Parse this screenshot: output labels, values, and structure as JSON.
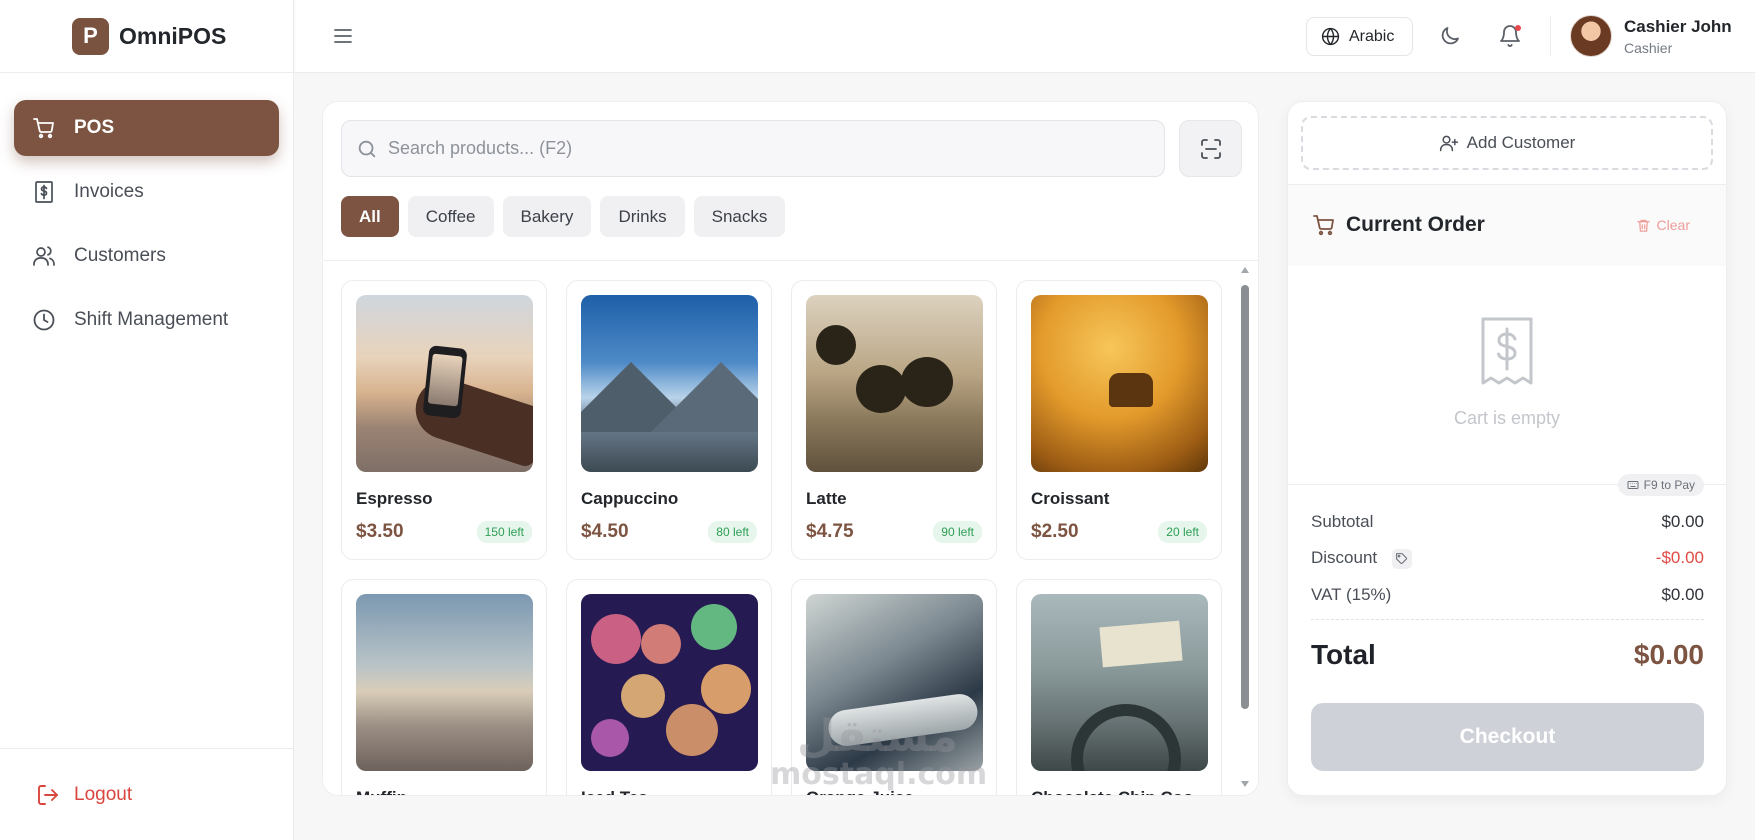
{
  "app": {
    "logo_letter": "P",
    "name": "OmniPOS"
  },
  "sidebar": {
    "items": [
      {
        "label": "POS",
        "icon": "cart-icon",
        "active": true
      },
      {
        "label": "Invoices",
        "icon": "invoice-icon",
        "active": false
      },
      {
        "label": "Customers",
        "icon": "users-icon",
        "active": false
      },
      {
        "label": "Shift Management",
        "icon": "clock-icon",
        "active": false
      }
    ],
    "logout_label": "Logout"
  },
  "header": {
    "language_label": "Arabic",
    "user": {
      "name": "Cashier John",
      "role": "Cashier"
    }
  },
  "search": {
    "placeholder": "Search products... (F2)",
    "value": ""
  },
  "categories": [
    {
      "label": "All",
      "active": true
    },
    {
      "label": "Coffee",
      "active": false
    },
    {
      "label": "Bakery",
      "active": false
    },
    {
      "label": "Drinks",
      "active": false
    },
    {
      "label": "Snacks",
      "active": false
    }
  ],
  "products": [
    {
      "name": "Espresso",
      "price": "$3.50",
      "stock": "150 left"
    },
    {
      "name": "Cappuccino",
      "price": "$4.50",
      "stock": "80 left"
    },
    {
      "name": "Latte",
      "price": "$4.75",
      "stock": "90 left"
    },
    {
      "name": "Croissant",
      "price": "$2.50",
      "stock": "20 left"
    },
    {
      "name": "Muffin",
      "price": "",
      "stock": ""
    },
    {
      "name": "Iced Tea",
      "price": "",
      "stock": ""
    },
    {
      "name": "Orange Juice",
      "price": "",
      "stock": ""
    },
    {
      "name": "Chocolate Chip Coo...",
      "price": "",
      "stock": ""
    }
  ],
  "order": {
    "add_customer_label": "Add Customer",
    "title": "Current Order",
    "clear_label": "Clear",
    "empty_text": "Cart is empty",
    "pay_hint": "F9 to Pay",
    "subtotal_label": "Subtotal",
    "subtotal_value": "$0.00",
    "discount_label": "Discount",
    "discount_value": "-$0.00",
    "vat_label": "VAT (15%)",
    "vat_value": "$0.00",
    "total_label": "Total",
    "total_value": "$0.00",
    "checkout_label": "Checkout"
  },
  "watermark": {
    "logo": "مستقل",
    "text": "mostaql.com"
  },
  "colors": {
    "brand": "#7c5441",
    "danger": "#d9463e",
    "stock_green": "#2f9e55",
    "checkout_disabled": "#cfd1d9"
  }
}
